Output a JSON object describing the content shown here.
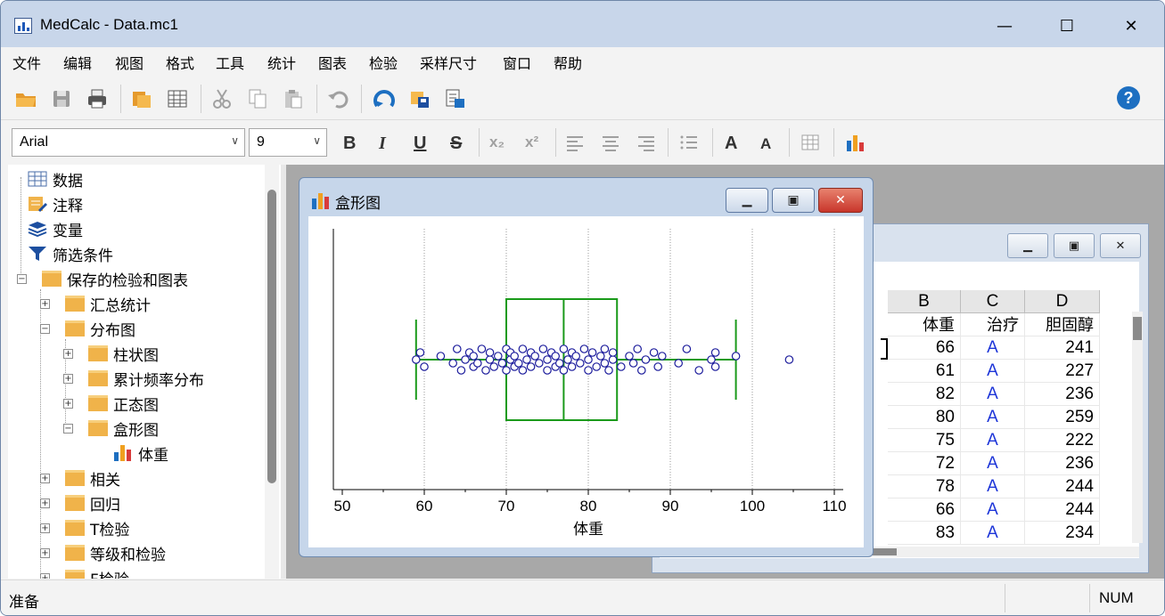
{
  "window": {
    "title": "MedCalc - Data.mc1",
    "minimize_label": "—",
    "maximize_label": "☐",
    "close_label": "✕"
  },
  "menu": [
    "文件",
    "编辑",
    "视图",
    "格式",
    "工具",
    "统计",
    "图表",
    "检验",
    "采样尺寸",
    "窗口",
    "帮助"
  ],
  "toolbar": {
    "icons": [
      "open-folder-icon",
      "save-icon",
      "print-icon",
      "folder-icon",
      "spreadsheet-icon",
      "cut-icon",
      "copy-icon",
      "paste-icon",
      "undo-icon",
      "refresh-icon",
      "export-icon",
      "export-word-icon"
    ],
    "help_icon": "help-icon",
    "help_label": "?"
  },
  "format_bar": {
    "font": "Arial",
    "size": "9",
    "bold": "B",
    "italic": "I",
    "underline": "U",
    "strike": "S",
    "subscript": "x₂",
    "superscript": "x²",
    "increase_font": "A",
    "decrease_font": "A"
  },
  "tree": [
    {
      "label": "数据",
      "icon": "table-icon",
      "level": 0
    },
    {
      "label": "注释",
      "icon": "notes-icon",
      "level": 0
    },
    {
      "label": "变量",
      "icon": "variables-icon",
      "level": 0
    },
    {
      "label": "筛选条件",
      "icon": "filter-icon",
      "level": 0
    },
    {
      "label": "保存的检验和图表",
      "icon": "folder-icon",
      "level": 0,
      "expander": "−"
    },
    {
      "label": "汇总统计",
      "icon": "folder-icon",
      "level": 1,
      "expander": "+"
    },
    {
      "label": "分布图",
      "icon": "folder-icon",
      "level": 1,
      "expander": "−"
    },
    {
      "label": "柱状图",
      "icon": "folder-icon",
      "level": 2,
      "expander": "+"
    },
    {
      "label": "累计频率分布",
      "icon": "folder-icon",
      "level": 2,
      "expander": "+"
    },
    {
      "label": "正态图",
      "icon": "folder-icon",
      "level": 2,
      "expander": "+"
    },
    {
      "label": "盒形图",
      "icon": "folder-icon",
      "level": 2,
      "expander": "−"
    },
    {
      "label": "体重",
      "icon": "chart-icon",
      "level": 3
    },
    {
      "label": "相关",
      "icon": "folder-icon",
      "level": 1,
      "expander": "+"
    },
    {
      "label": "回归",
      "icon": "folder-icon",
      "level": 1,
      "expander": "+"
    },
    {
      "label": "T检验",
      "icon": "folder-icon",
      "level": 1,
      "expander": "+"
    },
    {
      "label": "等级和检验",
      "icon": "folder-icon",
      "level": 1,
      "expander": "+"
    },
    {
      "label": "F检验",
      "icon": "folder-icon",
      "level": 1,
      "expander": "+"
    }
  ],
  "data_window": {
    "columns": [
      {
        "letter": "B",
        "name": "体重"
      },
      {
        "letter": "C",
        "name": "治疗"
      },
      {
        "letter": "D",
        "name": "胆固醇"
      }
    ],
    "rows": [
      [
        "66",
        "A",
        "241"
      ],
      [
        "61",
        "A",
        "227"
      ],
      [
        "82",
        "A",
        "236"
      ],
      [
        "80",
        "A",
        "259"
      ],
      [
        "75",
        "A",
        "222"
      ],
      [
        "72",
        "A",
        "236"
      ],
      [
        "78",
        "A",
        "244"
      ],
      [
        "66",
        "A",
        "244"
      ],
      [
        "83",
        "A",
        "234"
      ]
    ]
  },
  "plot_window": {
    "title": "盒形图",
    "minimize_label": "▁",
    "restore_label": "▣",
    "close_label": "✕"
  },
  "chart_data": {
    "type": "box",
    "orientation": "horizontal",
    "xlabel": "体重",
    "xlim": [
      50,
      110
    ],
    "xticks": [
      50,
      60,
      70,
      80,
      90,
      100,
      110
    ],
    "grid": true,
    "box": {
      "whisker_low": 59,
      "q1": 70,
      "median": 77,
      "q3": 83.5,
      "whisker_high": 98
    },
    "outliers": [
      104.5
    ],
    "colors": {
      "box": "#1a9a1a",
      "points": "#1c1c9c"
    },
    "points": [
      59,
      59.5,
      60,
      62,
      63.5,
      64,
      64.5,
      65,
      65.5,
      66,
      66,
      66.5,
      67,
      67.5,
      68,
      68,
      68.5,
      69,
      69.5,
      70,
      70,
      70.5,
      70.5,
      71,
      71,
      71.5,
      72,
      72,
      72.5,
      73,
      73,
      73.5,
      74,
      74.5,
      75,
      75,
      75.5,
      76,
      76,
      76.5,
      77,
      77,
      77.5,
      78,
      78,
      78.5,
      79,
      79.5,
      80,
      80,
      80.5,
      81,
      81.5,
      82,
      82,
      82.5,
      83,
      83,
      84,
      85,
      85.5,
      86,
      86.5,
      87,
      88,
      88.5,
      89,
      91,
      92,
      93.5,
      95,
      95.5,
      95.5,
      98
    ]
  },
  "status": {
    "text": "准备",
    "num": "NUM"
  }
}
